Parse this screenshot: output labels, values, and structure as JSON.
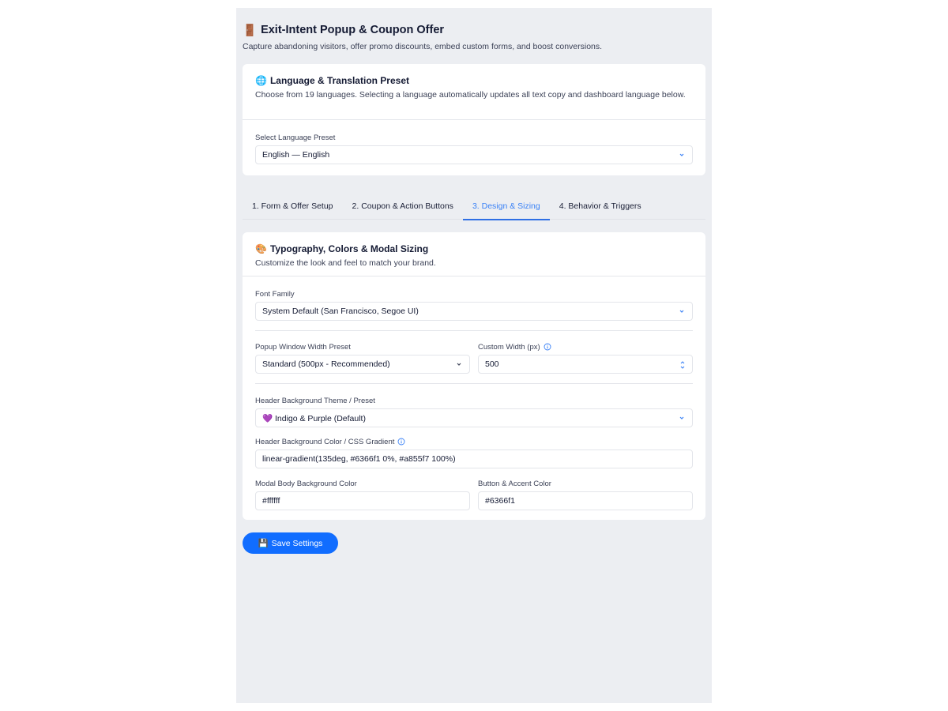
{
  "header": {
    "icon": "door-emoji",
    "title": "Exit-Intent Popup & Coupon Offer",
    "subtitle": "Capture abandoning visitors, offer promo discounts, embed custom forms, and boost conversions."
  },
  "language_card": {
    "icon": "globe-emoji",
    "title": "Language & Translation Preset",
    "description": "Choose from 19 languages. Selecting a language automatically updates all text copy and dashboard language below.",
    "select_label": "Select Language Preset",
    "select_value": "English — English"
  },
  "tabs": [
    {
      "label": "1. Form & Offer Setup",
      "active": false
    },
    {
      "label": "2. Coupon & Action Buttons",
      "active": false
    },
    {
      "label": "3. Design & Sizing",
      "active": true
    },
    {
      "label": "4. Behavior & Triggers",
      "active": false
    }
  ],
  "design_card": {
    "icon": "palette-emoji",
    "title": "Typography, Colors & Modal Sizing",
    "description": "Customize the look and feel to match your brand.",
    "font_family_label": "Font Family",
    "font_family_value": "System Default (San Francisco, Segoe UI)",
    "width_preset_label": "Popup Window Width Preset",
    "width_preset_value": "Standard (500px - Recommended)",
    "custom_width_label": "Custom Width (px)",
    "custom_width_value": "500",
    "header_theme_label": "Header Background Theme / Preset",
    "header_theme_value": "💜 Indigo & Purple (Default)",
    "header_gradient_label": "Header Background Color / CSS Gradient",
    "header_gradient_value": "linear-gradient(135deg, #6366f1 0%, #a855f7 100%)",
    "body_bg_label": "Modal Body Background Color",
    "body_bg_value": "#ffffff",
    "accent_label": "Button & Accent Color",
    "accent_value": "#6366f1"
  },
  "save_button": {
    "icon": "floppy-disk-emoji",
    "label": "Save Settings"
  },
  "colors": {
    "accent": "#116dff",
    "active_tab": "#3b82f6",
    "panel_bg": "#eceef2"
  }
}
